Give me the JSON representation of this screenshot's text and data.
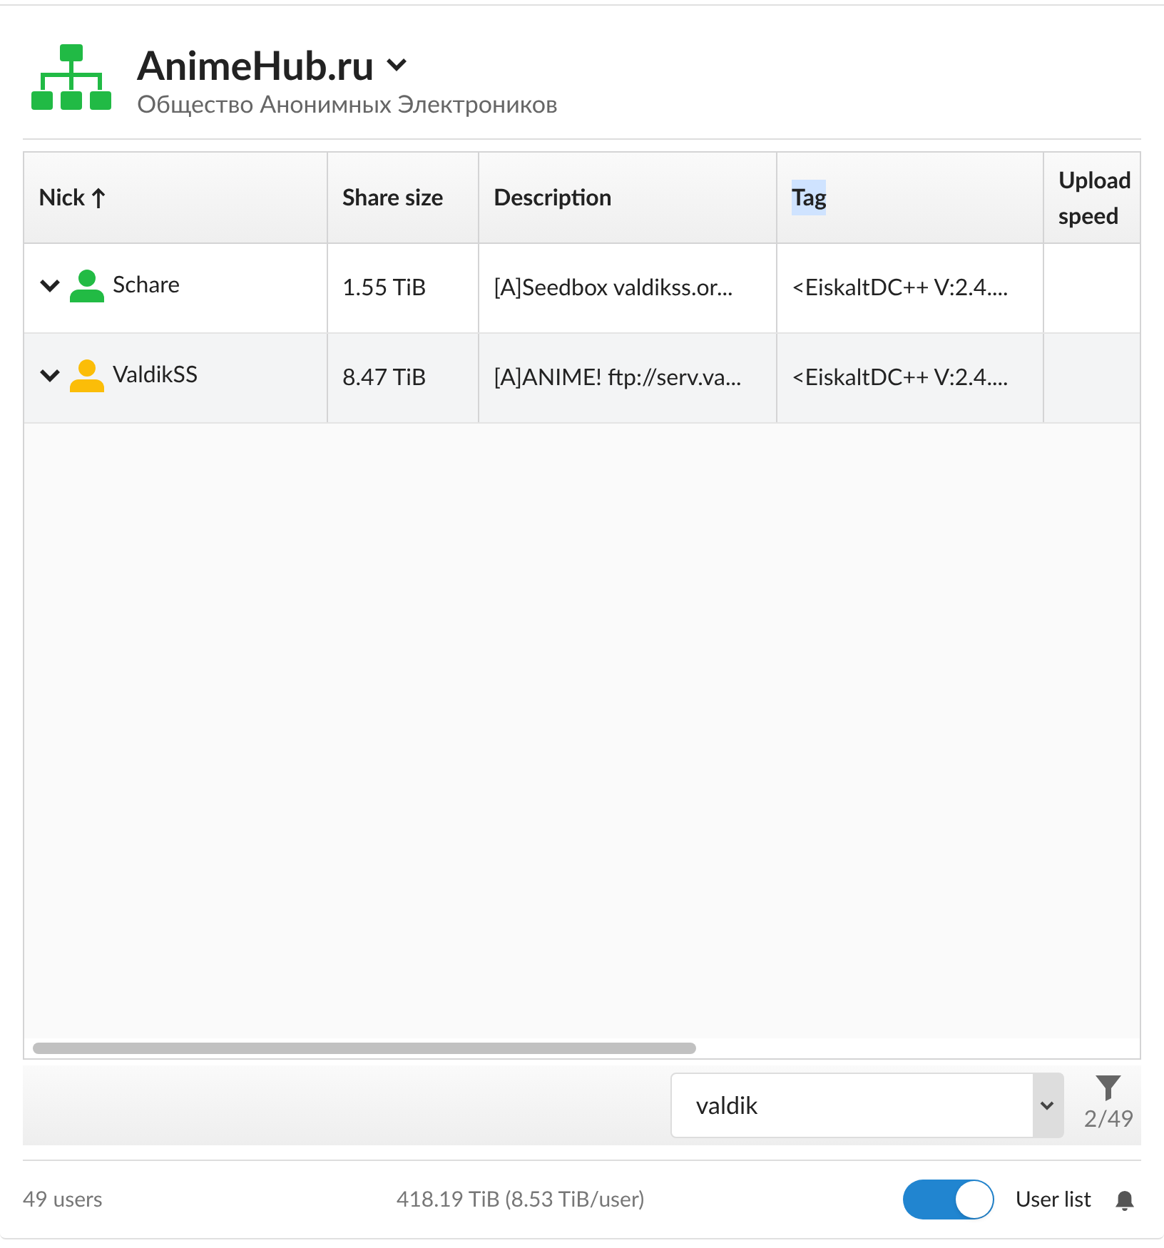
{
  "hub": {
    "name": "AnimeHub.ru",
    "description": "Общество Анонимных Электроников"
  },
  "table": {
    "columns": [
      {
        "label": "Nick",
        "sorted": true,
        "highlighted": false
      },
      {
        "label": "Share size",
        "sorted": false,
        "highlighted": false
      },
      {
        "label": "Description",
        "sorted": false,
        "highlighted": false
      },
      {
        "label": "Tag",
        "sorted": false,
        "highlighted": true
      },
      {
        "label": "Upload speed",
        "sorted": false,
        "highlighted": false
      }
    ],
    "rows": [
      {
        "nick": "Schare",
        "color": "#22bb44",
        "share": "1.55 TiB",
        "description": "[A]Seedbox valdikss.or...",
        "tag": "<EiskaltDC++ V:2.4...."
      },
      {
        "nick": "ValdikSS",
        "color": "#fbbd08",
        "share": "8.47 TiB",
        "description": "[A]ANIME! ftp://serv.va...",
        "tag": "<EiskaltDC++ V:2.4...."
      }
    ]
  },
  "filter": {
    "value": "valdik",
    "count": "2/49"
  },
  "footer": {
    "users": "49 users",
    "share": "418.19 TiB (8.53 TiB/user)",
    "user_list": {
      "label": "User list",
      "on": true
    }
  }
}
